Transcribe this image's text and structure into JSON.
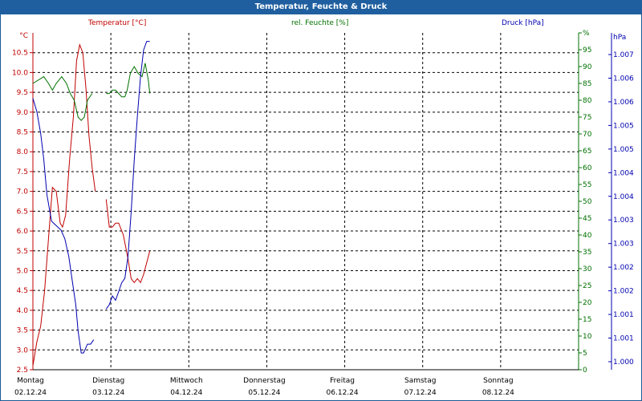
{
  "title": "Temperatur, Feuchte & Druck",
  "headers": {
    "temp": "Temperatur [°C]",
    "hum": "rel. Feuchte [%]",
    "press": "Druck [hPa]"
  },
  "units": {
    "left": "°C",
    "mid": "%",
    "right": "hPa"
  },
  "colors": {
    "temp": "#c00000",
    "hum": "#007000",
    "press": "#0000b0",
    "title_bg": "#1f5f9f",
    "grid": "#000000"
  },
  "chart_data": {
    "type": "line",
    "x_unit": "days since Monday 02.12.24 00:00",
    "days": [
      {
        "name": "Montag",
        "date": "02.12.24"
      },
      {
        "name": "Dienstag",
        "date": "03.12.24"
      },
      {
        "name": "Mittwoch",
        "date": "04.12.24"
      },
      {
        "name": "Donnerstag",
        "date": "05.12.24"
      },
      {
        "name": "Freitag",
        "date": "06.12.24"
      },
      {
        "name": "Samstag",
        "date": "07.12.24"
      },
      {
        "name": "Sonntag",
        "date": "08.12.24"
      }
    ],
    "axes": {
      "temp": {
        "min": 2.5,
        "max": 11.0,
        "ticks": [
          "2.5",
          "3.0",
          "3.5",
          "4.0",
          "4.5",
          "5.0",
          "5.5",
          "6.0",
          "6.5",
          "7.0",
          "7.5",
          "8.0",
          "8.5",
          "9.0",
          "9.5",
          "10.0",
          "10.5"
        ]
      },
      "hum": {
        "min": 0,
        "max": 100,
        "ticks": [
          "0",
          "5",
          "10",
          "15",
          "20",
          "25",
          "30",
          "35",
          "40",
          "45",
          "50",
          "55",
          "60",
          "65",
          "70",
          "75",
          "80",
          "85",
          "90",
          "95",
          "%"
        ]
      },
      "press": {
        "min": 1000.0,
        "max": 1007.5,
        "ticks": [
          "1.000",
          "1.001",
          "1.001",
          "1.002",
          "1.002",
          "1.003",
          "1.003",
          "1.004",
          "1.004",
          "1.005",
          "1.005",
          "1.006",
          "1.006",
          "1.007"
        ]
      }
    },
    "series": [
      {
        "name": "Temperatur [°C]",
        "axis": "temp",
        "color": "#c00000",
        "segments": [
          [
            [
              0.0,
              2.6
            ],
            [
              0.05,
              3.2
            ],
            [
              0.1,
              3.6
            ],
            [
              0.15,
              4.5
            ],
            [
              0.2,
              5.8
            ],
            [
              0.25,
              7.1
            ],
            [
              0.3,
              7.0
            ],
            [
              0.35,
              6.2
            ],
            [
              0.38,
              6.1
            ],
            [
              0.42,
              6.4
            ],
            [
              0.47,
              7.8
            ],
            [
              0.52,
              8.9
            ],
            [
              0.56,
              10.3
            ],
            [
              0.6,
              10.7
            ],
            [
              0.64,
              10.5
            ],
            [
              0.68,
              9.6
            ],
            [
              0.72,
              8.4
            ],
            [
              0.76,
              7.6
            ],
            [
              0.8,
              7.0
            ]
          ],
          [
            [
              0.94,
              6.8
            ],
            [
              0.98,
              6.1
            ],
            [
              1.02,
              6.1
            ],
            [
              1.06,
              6.2
            ],
            [
              1.1,
              6.2
            ],
            [
              1.16,
              5.9
            ],
            [
              1.22,
              5.3
            ],
            [
              1.26,
              4.8
            ],
            [
              1.3,
              4.7
            ],
            [
              1.34,
              4.8
            ],
            [
              1.38,
              4.7
            ],
            [
              1.42,
              4.9
            ],
            [
              1.46,
              5.2
            ],
            [
              1.5,
              5.5
            ]
          ]
        ]
      },
      {
        "name": "rel. Feuchte [%]",
        "axis": "hum",
        "color": "#007000",
        "segments": [
          [
            [
              0.0,
              85
            ],
            [
              0.07,
              86
            ],
            [
              0.14,
              87
            ],
            [
              0.2,
              85
            ],
            [
              0.25,
              83
            ],
            [
              0.3,
              85
            ],
            [
              0.37,
              87
            ],
            [
              0.43,
              85
            ],
            [
              0.48,
              82
            ],
            [
              0.53,
              80
            ],
            [
              0.58,
              75
            ],
            [
              0.62,
              74
            ],
            [
              0.66,
              75
            ],
            [
              0.7,
              80
            ],
            [
              0.76,
              82
            ]
          ],
          [
            [
              0.94,
              82
            ],
            [
              0.98,
              82
            ],
            [
              1.02,
              83
            ],
            [
              1.06,
              83
            ],
            [
              1.1,
              82
            ],
            [
              1.14,
              81
            ],
            [
              1.18,
              81
            ],
            [
              1.21,
              83
            ],
            [
              1.25,
              88
            ],
            [
              1.3,
              90
            ],
            [
              1.35,
              88
            ],
            [
              1.4,
              87
            ],
            [
              1.44,
              91
            ],
            [
              1.48,
              86
            ],
            [
              1.5,
              82
            ]
          ]
        ]
      },
      {
        "name": "Druck [hPa]",
        "axis": "press",
        "color": "#0000b0",
        "segments": [
          [
            [
              0.0,
              1006.0
            ],
            [
              0.05,
              1005.7
            ],
            [
              0.1,
              1005.2
            ],
            [
              0.14,
              1004.6
            ],
            [
              0.18,
              1003.8
            ],
            [
              0.24,
              1003.2
            ],
            [
              0.3,
              1003.1
            ],
            [
              0.36,
              1003.0
            ],
            [
              0.41,
              1002.8
            ],
            [
              0.46,
              1002.4
            ],
            [
              0.5,
              1001.9
            ],
            [
              0.55,
              1001.3
            ],
            [
              0.58,
              1000.7
            ],
            [
              0.62,
              1000.2
            ],
            [
              0.65,
              1000.2
            ],
            [
              0.7,
              1000.4
            ],
            [
              0.74,
              1000.4
            ],
            [
              0.78,
              1000.5
            ]
          ],
          [
            [
              0.94,
              1001.2
            ],
            [
              0.98,
              1001.3
            ],
            [
              1.02,
              1001.5
            ],
            [
              1.06,
              1001.4
            ],
            [
              1.1,
              1001.6
            ],
            [
              1.14,
              1001.8
            ],
            [
              1.18,
              1001.9
            ],
            [
              1.22,
              1002.4
            ],
            [
              1.26,
              1003.4
            ],
            [
              1.3,
              1004.6
            ],
            [
              1.34,
              1005.6
            ],
            [
              1.38,
              1006.5
            ],
            [
              1.42,
              1007.1
            ],
            [
              1.46,
              1007.3
            ],
            [
              1.5,
              1007.3
            ]
          ]
        ]
      }
    ]
  }
}
